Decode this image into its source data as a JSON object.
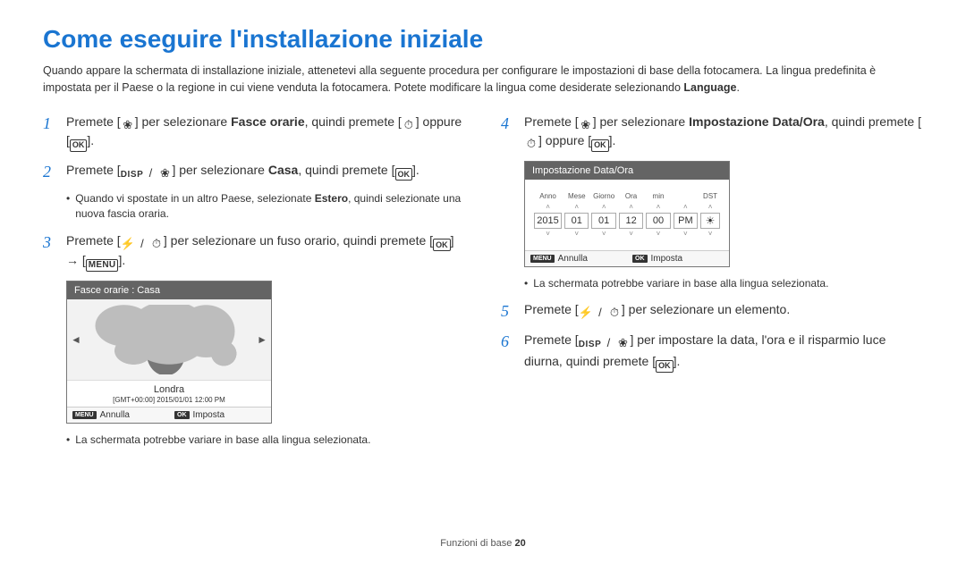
{
  "title": "Come eseguire l'installazione iniziale",
  "intro_a": "Quando appare la schermata di installazione iniziale, attenetevi alla seguente procedura per configurare le impostazioni di base della fotocamera. La lingua predefinita è impostata per il Paese o la regione in cui viene venduta la fotocamera. Potete modificare la lingua come desiderate selezionando ",
  "intro_lang": "Language",
  "steps": {
    "s1_a": "Premete [",
    "s1_b": "] per selezionare ",
    "s1_bold": "Fasce orarie",
    "s1_c": ", quindi premete [",
    "s1_d": "] oppure [",
    "s1_e": "].",
    "s2_a": "Premete [",
    "s2_b": "] per selezionare ",
    "s2_bold": "Casa",
    "s2_c": ", quindi premete [",
    "s2_d": "].",
    "s2_sub_a": "Quando vi spostate in un altro Paese, selezionate ",
    "s2_sub_bold": "Estero",
    "s2_sub_b": ", quindi selezionate una nuova fascia oraria.",
    "s3_a": "Premete [",
    "s3_b": "] per selezionare un fuso orario, quindi premete [",
    "s3_c": "] → [",
    "s3_d": "].",
    "note_screen": "La schermata potrebbe variare in base alla lingua selezionata.",
    "s4_a": "Premete [",
    "s4_b": "] per selezionare ",
    "s4_bold": "Impostazione Data/Ora",
    "s4_c": ", quindi premete [",
    "s4_d": "] oppure [",
    "s4_e": "].",
    "s5_a": "Premete [",
    "s5_b": "] per selezionare un elemento.",
    "s6_a": "Premete [",
    "s6_b": "] per impostare la data, l'ora e il risparmio luce diurna, quindi premete [",
    "s6_c": "]."
  },
  "glyphs": {
    "macro": "❀",
    "timer": "⏱",
    "flash": "⚡",
    "ok": "OK",
    "disp": "DISP",
    "menu": "MENU",
    "slash": "/"
  },
  "screen1": {
    "header": "Fasce orarie : Casa",
    "city": "Londra",
    "tz": "[GMT+00:00]  2015/01/01  12:00 PM",
    "cancel": "Annulla",
    "set": "Imposta"
  },
  "screen2": {
    "header": "Impostazione Data/Ora",
    "labels": [
      "Anno",
      "Mese",
      "Giorno",
      "Ora",
      "min",
      "DST"
    ],
    "values": [
      "2015",
      "01",
      "01",
      "12",
      "00",
      "PM"
    ],
    "dst_icon": "☀",
    "cancel": "Annulla",
    "set": "Imposta"
  },
  "footer_a": "Funzioni di base  ",
  "footer_page": "20"
}
